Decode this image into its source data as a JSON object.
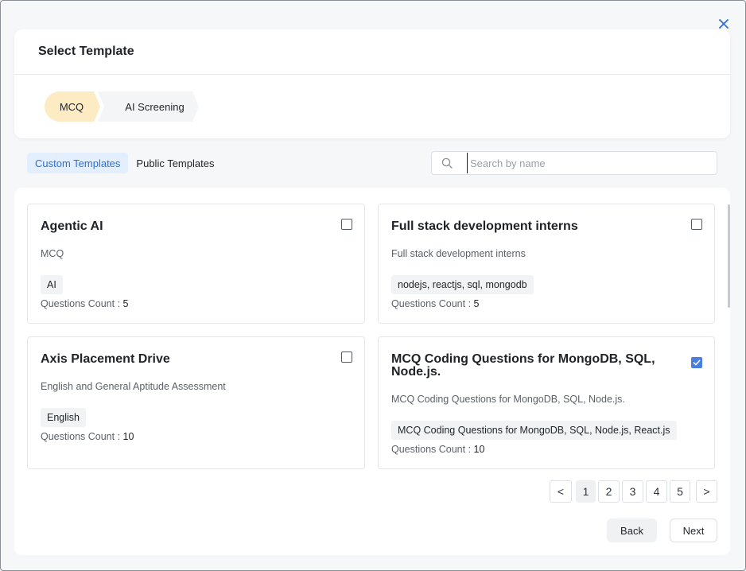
{
  "header": {
    "title": "Select Template",
    "steps": [
      {
        "label": "MCQ",
        "active": true
      },
      {
        "label": "AI Screening",
        "active": false
      }
    ]
  },
  "tabs": [
    {
      "label": "Custom Templates",
      "active": true
    },
    {
      "label": "Public Templates",
      "active": false
    }
  ],
  "search": {
    "placeholder": "Search by name",
    "value": ""
  },
  "templates": [
    {
      "title": "Agentic AI",
      "subtitle": "MCQ",
      "tag": "AI",
      "count_label": "Questions Count : ",
      "count": "5",
      "checked": false
    },
    {
      "title": "Full stack development interns",
      "subtitle": "Full stack development interns",
      "tag": "nodejs, reactjs, sql, mongodb",
      "count_label": "Questions Count : ",
      "count": "5",
      "checked": false
    },
    {
      "title": "Axis Placement Drive",
      "subtitle": "English and General Aptitude Assessment",
      "tag": "English",
      "count_label": "Questions Count : ",
      "count": "10",
      "checked": false
    },
    {
      "title": "MCQ Coding Questions for MongoDB, SQL, Node.js.",
      "subtitle": "MCQ Coding Questions for MongoDB, SQL, Node.js.",
      "tag": "MCQ Coding Questions for MongoDB, SQL, Node.js, React.js",
      "count_label": "Questions Count : ",
      "count": "10",
      "checked": true
    }
  ],
  "pagination": {
    "prev": "<",
    "next": ">",
    "pages": [
      "1",
      "2",
      "3",
      "4",
      "5"
    ],
    "current": "1"
  },
  "footer": {
    "back_label": "Back",
    "next_label": "Next"
  },
  "colors": {
    "accent": "#2f6fd6",
    "step_active": "#fdebc4",
    "checkbox_checked": "#4a7fe0"
  },
  "icons": {
    "close": "close-icon",
    "search": "search-icon",
    "check": "check-icon"
  }
}
